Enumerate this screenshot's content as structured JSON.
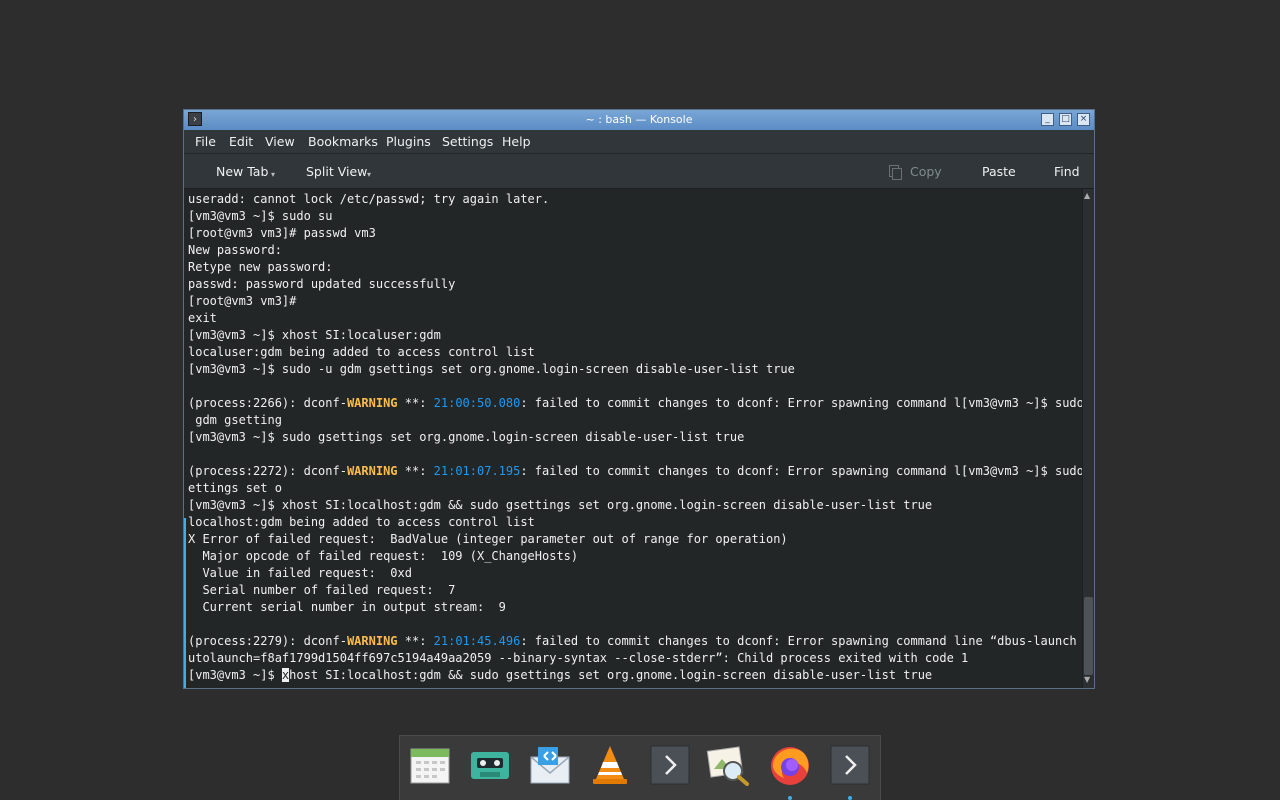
{
  "window": {
    "title": "~ : bash — Konsole",
    "controls": {
      "minimize": "_",
      "maximize": "□",
      "close": "×"
    }
  },
  "menubar": {
    "items": [
      "File",
      "Edit",
      "View",
      "Bookmarks",
      "Plugins",
      "Settings",
      "Help"
    ]
  },
  "toolbar": {
    "new_tab": "New Tab",
    "split_view": "Split View",
    "copy": "Copy",
    "paste": "Paste",
    "find": "Find"
  },
  "terminal": {
    "lines": [
      [
        {
          "t": "useradd: cannot lock /etc/passwd; try again later."
        }
      ],
      [
        {
          "t": "[vm3@vm3 ~]$ sudo su"
        }
      ],
      [
        {
          "t": "[root@vm3 vm3]# passwd vm3"
        }
      ],
      [
        {
          "t": "New password:"
        }
      ],
      [
        {
          "t": "Retype new password:"
        }
      ],
      [
        {
          "t": "passwd: password updated successfully"
        }
      ],
      [
        {
          "t": "[root@vm3 vm3]#"
        }
      ],
      [
        {
          "t": "exit"
        }
      ],
      [
        {
          "t": "[vm3@vm3 ~]$ xhost SI:localuser:gdm"
        }
      ],
      [
        {
          "t": "localuser:gdm being added to access control list"
        }
      ],
      [
        {
          "t": "[vm3@vm3 ~]$ sudo -u gdm gsettings set org.gnome.login-screen disable-user-list true"
        }
      ],
      [
        {
          "t": ""
        }
      ],
      [
        {
          "t": "(process:2266): dconf-"
        },
        {
          "t": "WARNING",
          "c": "warn"
        },
        {
          "t": " **: "
        },
        {
          "t": "21:00:50.080",
          "c": "ts"
        },
        {
          "t": ": failed to commit changes to dconf: Error spawning command l[vm3@vm3 ~]$ sudo -u"
        }
      ],
      [
        {
          "t": " gdm gsetting"
        }
      ],
      [
        {
          "t": "[vm3@vm3 ~]$ sudo gsettings set org.gnome.login-screen disable-user-list true"
        }
      ],
      [
        {
          "t": ""
        }
      ],
      [
        {
          "t": "(process:2272): dconf-"
        },
        {
          "t": "WARNING",
          "c": "warn"
        },
        {
          "t": " **: "
        },
        {
          "t": "21:01:07.195",
          "c": "ts"
        },
        {
          "t": ": failed to commit changes to dconf: Error spawning command l[vm3@vm3 ~]$ sudo gs"
        }
      ],
      [
        {
          "t": "ettings set o"
        }
      ],
      [
        {
          "t": "[vm3@vm3 ~]$ xhost SI:localhost:gdm && sudo gsettings set org.gnome.login-screen disable-user-list true"
        }
      ],
      [
        {
          "t": "localhost:gdm being added to access control list"
        }
      ],
      [
        {
          "t": "X Error of failed request:  BadValue (integer parameter out of range for operation)"
        }
      ],
      [
        {
          "t": "  Major opcode of failed request:  109 (X_ChangeHosts)"
        }
      ],
      [
        {
          "t": "  Value in failed request:  0xd"
        }
      ],
      [
        {
          "t": "  Serial number of failed request:  7"
        }
      ],
      [
        {
          "t": "  Current serial number in output stream:  9"
        }
      ],
      [
        {
          "t": ""
        }
      ],
      [
        {
          "t": "(process:2279): dconf-"
        },
        {
          "t": "WARNING",
          "c": "warn"
        },
        {
          "t": " **: "
        },
        {
          "t": "21:01:45.496",
          "c": "ts"
        },
        {
          "t": ": failed to commit changes to dconf: Error spawning command line “dbus-launch --a"
        }
      ],
      [
        {
          "t": "utolaunch=f8af1799d1504ff697c5194a49aa2059 --binary-syntax --close-stderr”: Child process exited with code 1"
        }
      ],
      [
        {
          "t": "[vm3@vm3 ~]$ "
        },
        {
          "t": "x",
          "c": "cursor"
        },
        {
          "t": "host SI:localhost:gdm && sudo gsettings set org.gnome.login-screen disable-user-list true"
        }
      ]
    ]
  },
  "dock": {
    "items": [
      {
        "name": "calendar-icon",
        "running": false
      },
      {
        "name": "cassette-player-icon",
        "running": false
      },
      {
        "name": "mail-client-icon",
        "running": false
      },
      {
        "name": "vlc-cone-icon",
        "running": false
      },
      {
        "name": "terminal-prompt-icon",
        "running": false
      },
      {
        "name": "image-viewer-icon",
        "running": false
      },
      {
        "name": "firefox-icon",
        "running": true
      },
      {
        "name": "konsole-icon",
        "running": true
      }
    ]
  },
  "colors": {
    "warning": "#fdbc4b",
    "timestamp": "#1d99f3",
    "accent": "#3daee9",
    "terminal_bg": "#232627"
  }
}
